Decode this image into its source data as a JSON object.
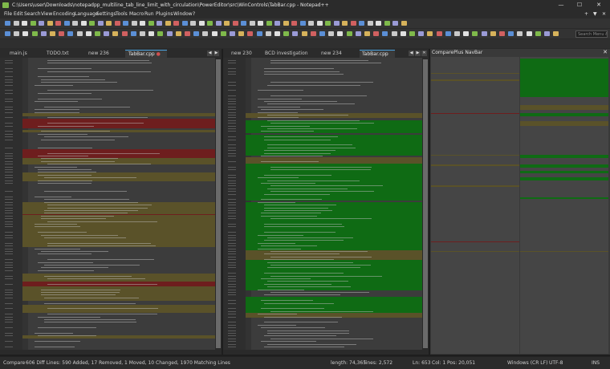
{
  "window": {
    "title": "C:\\Users\\user\\Downloads\\notepadpp_multiline_tab_line_limit_with_circulation\\PowerEditor\\src\\WinControls\\TabBar.cpp - Notepad++",
    "minimize_glyph": "—",
    "maximize_glyph": "☐",
    "close_glyph": "✕"
  },
  "menu": {
    "items": [
      "File",
      "Edit",
      "Search",
      "View",
      "Encoding",
      "Language",
      "Settings",
      "Tools",
      "Macro",
      "Run",
      "Plugins",
      "Window",
      "?"
    ],
    "right_glyphs": [
      "+",
      "▼",
      "✕"
    ]
  },
  "search": {
    "placeholder": "Search Menu & C"
  },
  "left_tabs": {
    "tabs": [
      {
        "label": "main.js"
      },
      {
        "label": "TODO.txt"
      },
      {
        "label": "new 236"
      },
      {
        "label": "TabBar.cpp"
      }
    ],
    "nav": [
      "◀",
      "▶",
      "✕"
    ]
  },
  "right_tabs": {
    "tabs": [
      {
        "label": "new 230"
      },
      {
        "label": "BCD investigation"
      },
      {
        "label": "new 234"
      },
      {
        "label": "TabBar.cpp"
      }
    ],
    "nav": [
      "◀",
      "▶",
      "✕"
    ]
  },
  "navbar": {
    "title": "ComparePlus NavBar",
    "close": "✕"
  },
  "status": {
    "mode": "Compare",
    "summary": "606 Diff Lines: 590 Added, 17 Removed, 1 Moved, 10 Changed,   1970 Matching Lines",
    "length": "length: 74,365",
    "lines": "lines: 2,572",
    "ln": "Ln: 653",
    "col": "Col: 1",
    "pos": "Pos: 20,051",
    "eol": "Windows (CR LF)",
    "encoding": "UTF-8",
    "ins": "INS"
  },
  "colors": {
    "added": "#0f6b14",
    "removed": "#6e1e1e",
    "changed": "#5a5229",
    "moved": "#6b6b40",
    "accent": "#4aa3df"
  }
}
